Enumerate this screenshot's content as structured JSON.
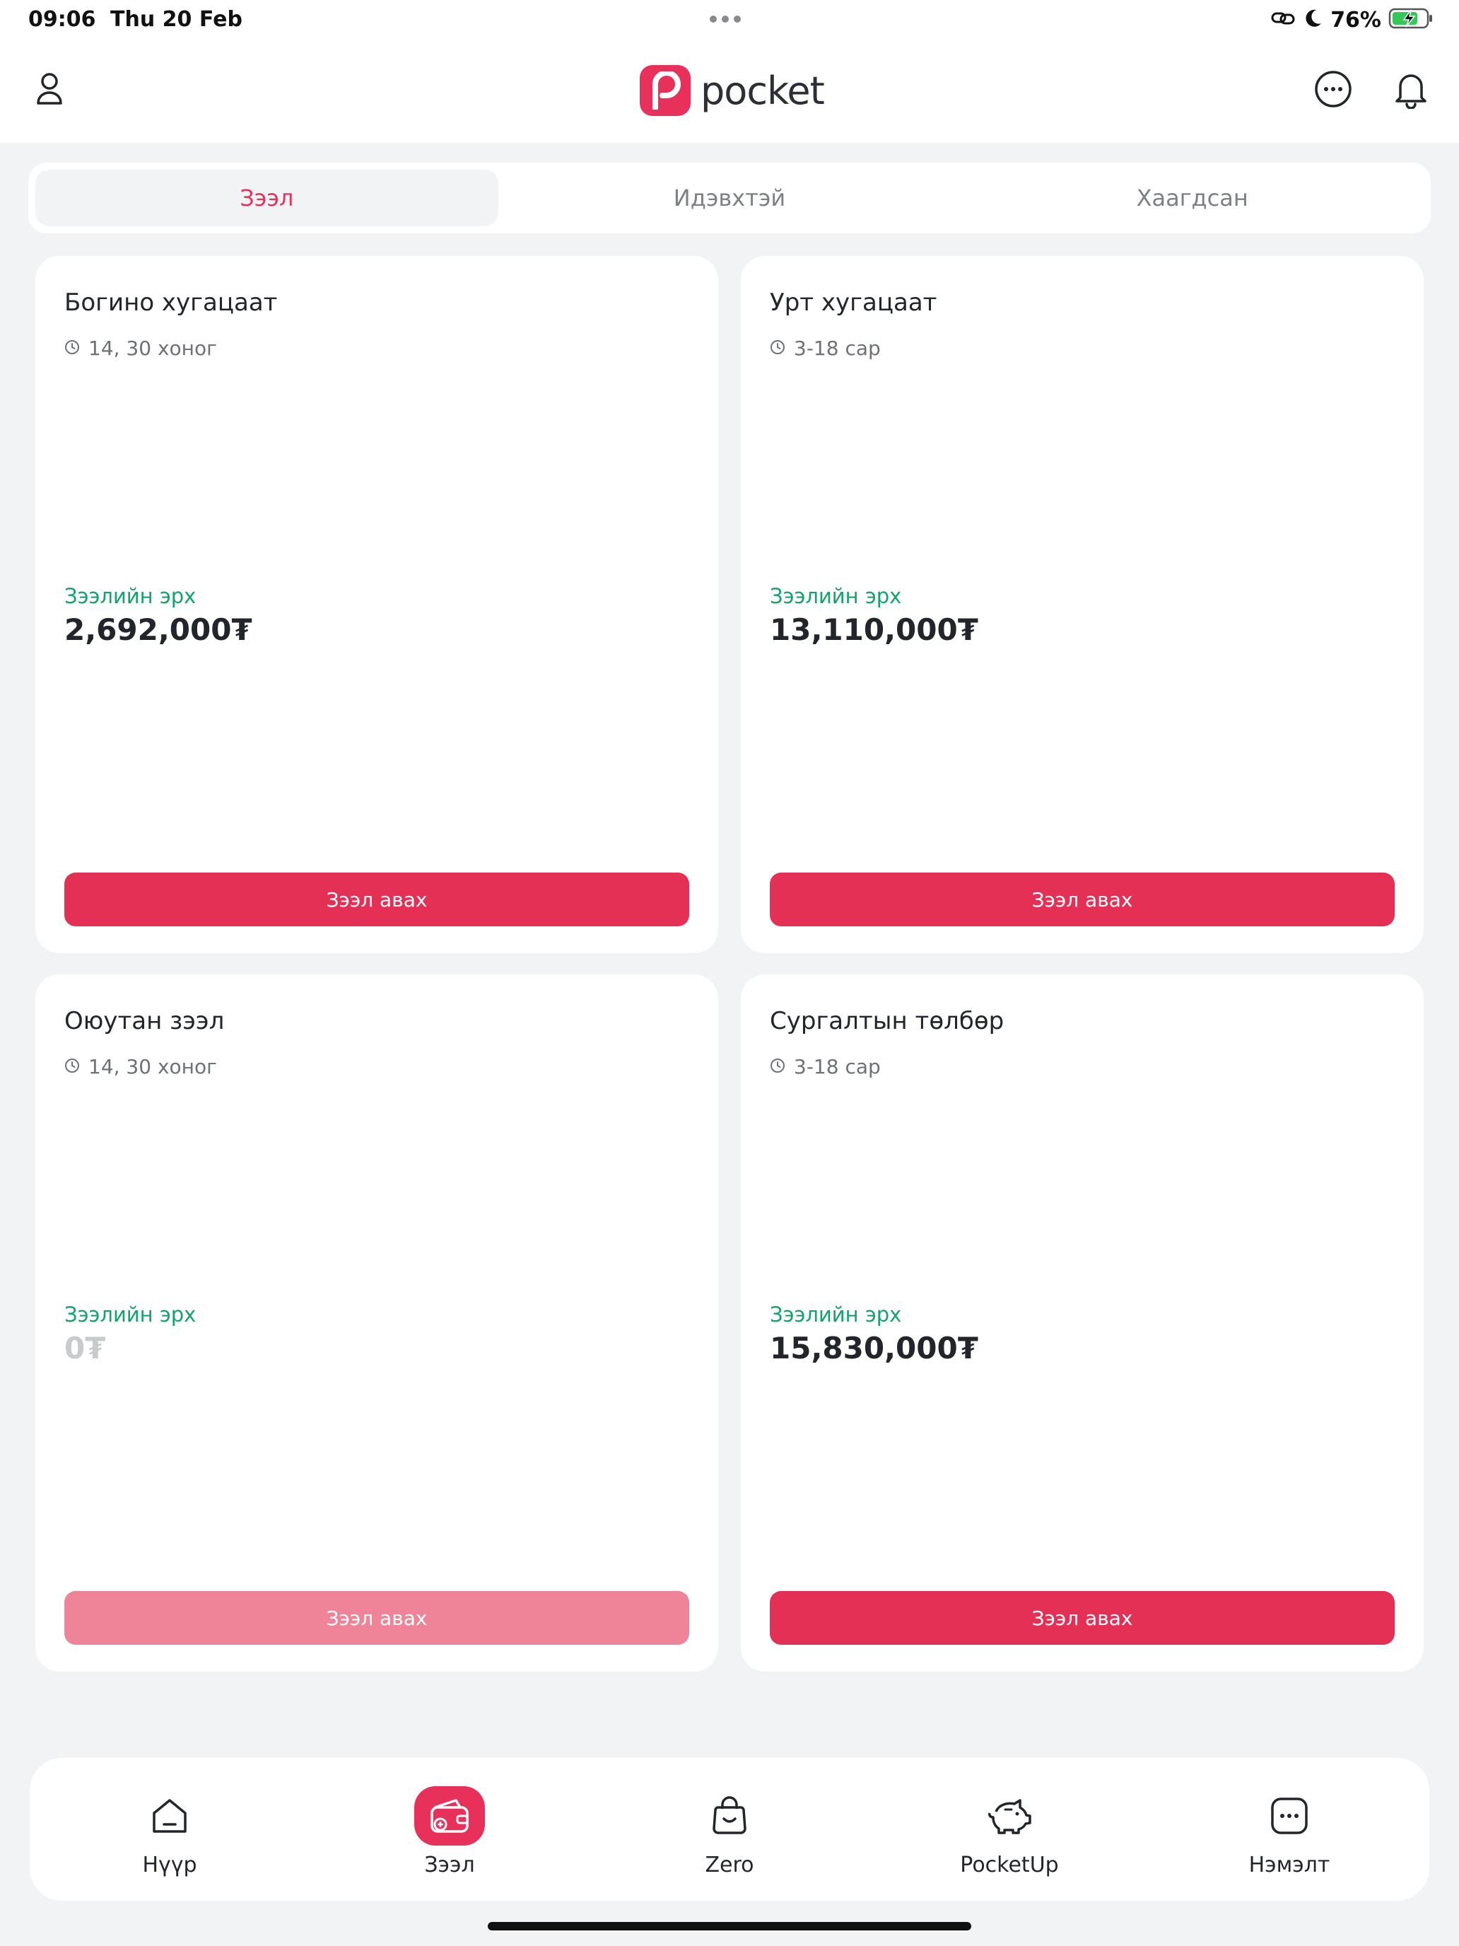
{
  "status_bar": {
    "time": "09:06",
    "date": "Thu 20 Feb",
    "battery_percent": "76%",
    "battery_level": 0.76,
    "icons": [
      "link-icon",
      "moon-icon",
      "battery-charging-icon"
    ]
  },
  "header": {
    "logo_text": "pocket",
    "left_icon": "user-icon",
    "right_icons": [
      "more-icon",
      "bell-icon"
    ]
  },
  "tabs": [
    {
      "label": "Зээл",
      "active": true
    },
    {
      "label": "Идэвхтэй",
      "active": false
    },
    {
      "label": "Хаагдсан",
      "active": false
    }
  ],
  "cards": [
    {
      "title": "Богино хугацаат",
      "term": "14, 30 хоног",
      "limit_label": "Зээлийн эрх",
      "limit_value": "2,692,000₮",
      "button": "Зээл авах",
      "enabled": true
    },
    {
      "title": "Урт хугацаат",
      "term": "3-18 сар",
      "limit_label": "Зээлийн эрх",
      "limit_value": "13,110,000₮",
      "button": "Зээл авах",
      "enabled": true
    },
    {
      "title": "Оюутан зээл",
      "term": "14, 30 хоног",
      "limit_label": "Зээлийн эрх",
      "limit_value": "0₮",
      "button": "Зээл авах",
      "enabled": false
    },
    {
      "title": "Сургалтын төлбөр",
      "term": "3-18 сар",
      "limit_label": "Зээлийн эрх",
      "limit_value": "15,830,000₮",
      "button": "Зээл авах",
      "enabled": true
    }
  ],
  "bottom_nav": [
    {
      "label": "Нүүр",
      "icon": "home-icon",
      "active": false
    },
    {
      "label": "Зээл",
      "icon": "wallet-icon",
      "active": true
    },
    {
      "label": "Zero",
      "icon": "bag-icon",
      "active": false
    },
    {
      "label": "PocketUp",
      "icon": "piggy-bank-icon",
      "active": false
    },
    {
      "label": "Нэмэлт",
      "icon": "more-square-icon",
      "active": false
    }
  ],
  "colors": {
    "accent": "#e8315a",
    "button": "#e53056",
    "button_disabled": "#ef8499",
    "limit_label": "#14a36b",
    "background": "#f2f3f5"
  }
}
